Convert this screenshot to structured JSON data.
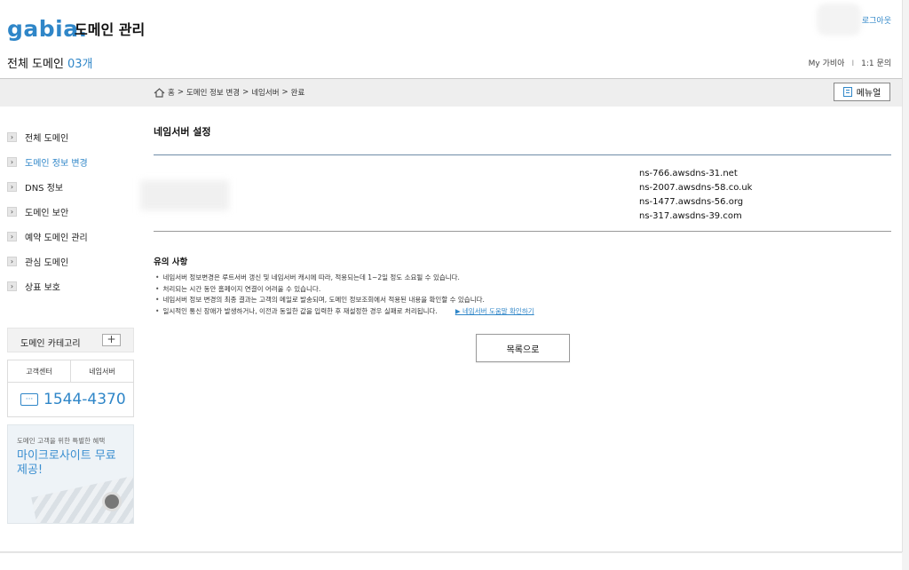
{
  "header": {
    "logo_text": "gabia",
    "title": "도메인 관리",
    "logout": "로그아웃",
    "domain_count_label": "전체 도메인",
    "domain_count_value": "03개",
    "links": [
      "My 가비아",
      "1:1 문의"
    ],
    "link_separator": "I"
  },
  "breadcrumb": {
    "items": [
      "홈",
      "도메인 정보 변경",
      "네임서버",
      "완료"
    ],
    "separator": ">",
    "manual_button": "메뉴얼"
  },
  "sidebar": {
    "items": [
      {
        "label": "전체 도메인"
      },
      {
        "label": "도메인 정보 변경"
      },
      {
        "label": "DNS 정보"
      },
      {
        "label": "도메인 보안"
      },
      {
        "label": "예약 도메인 관리"
      },
      {
        "label": "관심 도메인"
      },
      {
        "label": "상표 보호"
      }
    ],
    "active_index": 1,
    "category_label": "도메인 카테고리",
    "category_add": "+",
    "contact_tabs": [
      "고객센터",
      "네임서버"
    ],
    "phone_number": "1544-4370",
    "promo_small": "도메인 고객을 위한 특별한 혜택",
    "promo_big": "마이크로사이트 무료 제공!"
  },
  "main": {
    "section_title": "네임서버 설정",
    "nameservers": [
      "ns-766.awsdns-31.net",
      "ns-2007.awsdns-58.co.uk",
      "ns-1477.awsdns-56.org",
      "ns-317.awsdns-39.com"
    ],
    "notice_title": "유의 사항",
    "notices": [
      "네임서버 정보변경은 루트서버 갱신 및 네임서버 캐시에 따라, 적용되는데 1~2일 정도 소요될 수 있습니다.",
      "처리되는 시간 동안 홈페이지 연결이 어려울 수 있습니다.",
      "네임서버 정보 변경의 최종 결과는 고객의 메일로 발송되며, 도메인 정보조회에서 적용된 내용을 확인할 수 있습니다.",
      "일시적인 통신 장애가 발생하거나, 이전과 동일한 값을 입력한 후 재설정한 경우 실패로 처리됩니다."
    ],
    "help_link": "▶ 네임서버 도움말 확인하기",
    "back_button": "목록으로"
  },
  "colors": {
    "accent": "#2f86c8",
    "rule": "#6f8ca8"
  }
}
